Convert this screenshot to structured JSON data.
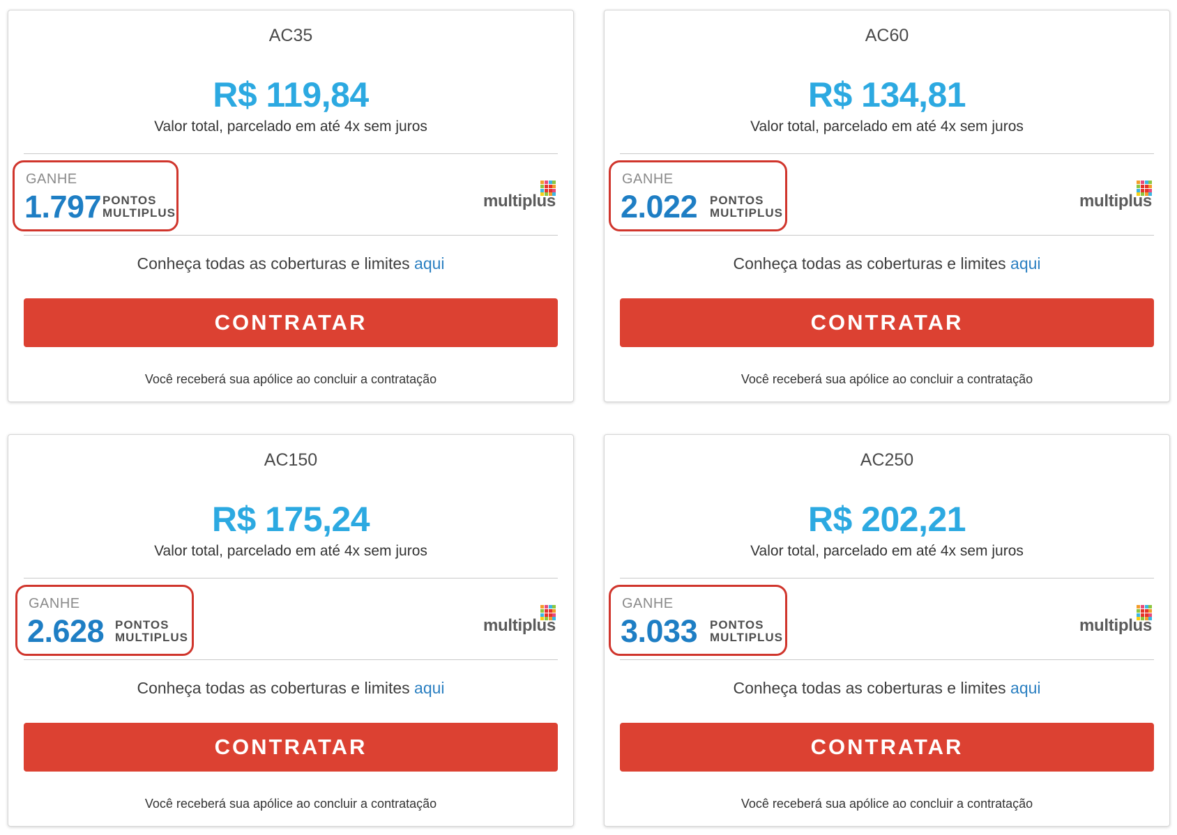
{
  "plans": [
    {
      "name": "AC35",
      "price": "R$ 119,84",
      "price_caption": "Valor total, parcelado em até 4x sem juros",
      "earn_label": "GANHE",
      "points": "1.797",
      "points_unit_line1": "PONTOS",
      "points_unit_line2": "MULTIPLUS",
      "partner_logo": "multiplus",
      "coverage_text": "Conheça todas as coberturas e limites ",
      "coverage_link": "aqui",
      "cta_label": "CONTRATAR",
      "policy_note": "Você receberá sua apólice ao concluir a contratação"
    },
    {
      "name": "AC60",
      "price": "R$ 134,81",
      "price_caption": "Valor total, parcelado em até 4x sem juros",
      "earn_label": "GANHE",
      "points": "2.022",
      "points_unit_line1": "PONTOS",
      "points_unit_line2": "MULTIPLUS",
      "partner_logo": "multiplus",
      "coverage_text": "Conheça todas as coberturas e limites ",
      "coverage_link": "aqui",
      "cta_label": "CONTRATAR",
      "policy_note": "Você receberá sua apólice ao concluir a contratação"
    },
    {
      "name": "AC150",
      "price": "R$ 175,24",
      "price_caption": "Valor total, parcelado em até 4x sem juros",
      "earn_label": "GANHE",
      "points": "2.628",
      "points_unit_line1": "PONTOS",
      "points_unit_line2": "MULTIPLUS",
      "partner_logo": "multiplus",
      "coverage_text": "Conheça todas as coberturas e limites ",
      "coverage_link": "aqui",
      "cta_label": "CONTRATAR",
      "policy_note": "Você receberá sua apólice ao concluir a contratação"
    },
    {
      "name": "AC250",
      "price": "R$ 202,21",
      "price_caption": "Valor total, parcelado em até 4x sem juros",
      "earn_label": "GANHE",
      "points": "3.033",
      "points_unit_line1": "PONTOS",
      "points_unit_line2": "MULTIPLUS",
      "partner_logo": "multiplus",
      "coverage_text": "Conheça todas as coberturas e limites ",
      "coverage_link": "aqui",
      "cta_label": "CONTRATAR",
      "policy_note": "Você receberá sua apólice ao concluir a contratação"
    }
  ],
  "colors": {
    "price": "#2ca9e1",
    "points": "#1e7ec4",
    "cta": "#dc4132",
    "highlight_outline": "#d0352c",
    "link": "#2a7fc1"
  }
}
